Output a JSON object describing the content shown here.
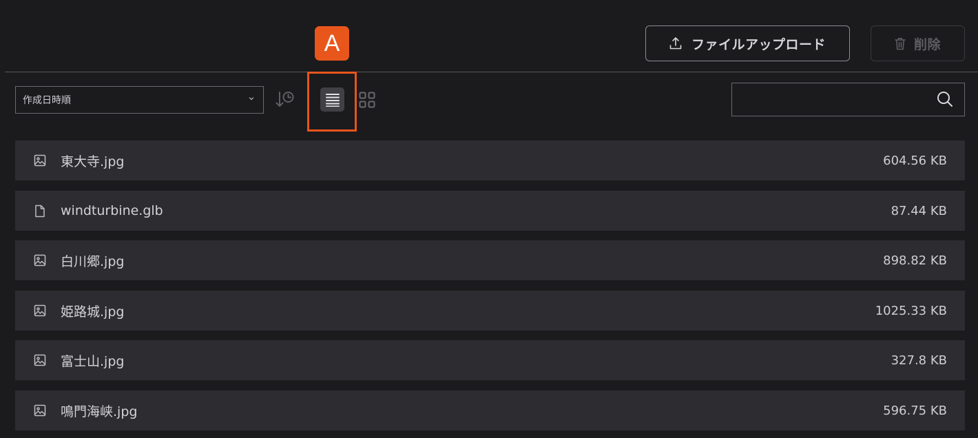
{
  "toolbar": {
    "upload_label": "ファイルアップロード",
    "delete_label": "削除"
  },
  "annotation": {
    "badge_label": "A"
  },
  "controls": {
    "sort_select_value": "作成日時順",
    "search_value": "",
    "active_view": "list"
  },
  "colors": {
    "background": "#1b1a1d",
    "row_background": "#2d2c31",
    "accent": "#e8561c"
  },
  "files": [
    {
      "name": "東大寺.jpg",
      "size": "604.56 KB",
      "icon": "image-icon"
    },
    {
      "name": "windturbine.glb",
      "size": "87.44 KB",
      "icon": "file-icon"
    },
    {
      "name": "白川郷.jpg",
      "size": "898.82 KB",
      "icon": "image-icon"
    },
    {
      "name": "姫路城.jpg",
      "size": "1025.33 KB",
      "icon": "image-icon"
    },
    {
      "name": "富士山.jpg",
      "size": "327.8 KB",
      "icon": "image-icon"
    },
    {
      "name": "鳴門海峡.jpg",
      "size": "596.75 KB",
      "icon": "image-icon"
    }
  ]
}
